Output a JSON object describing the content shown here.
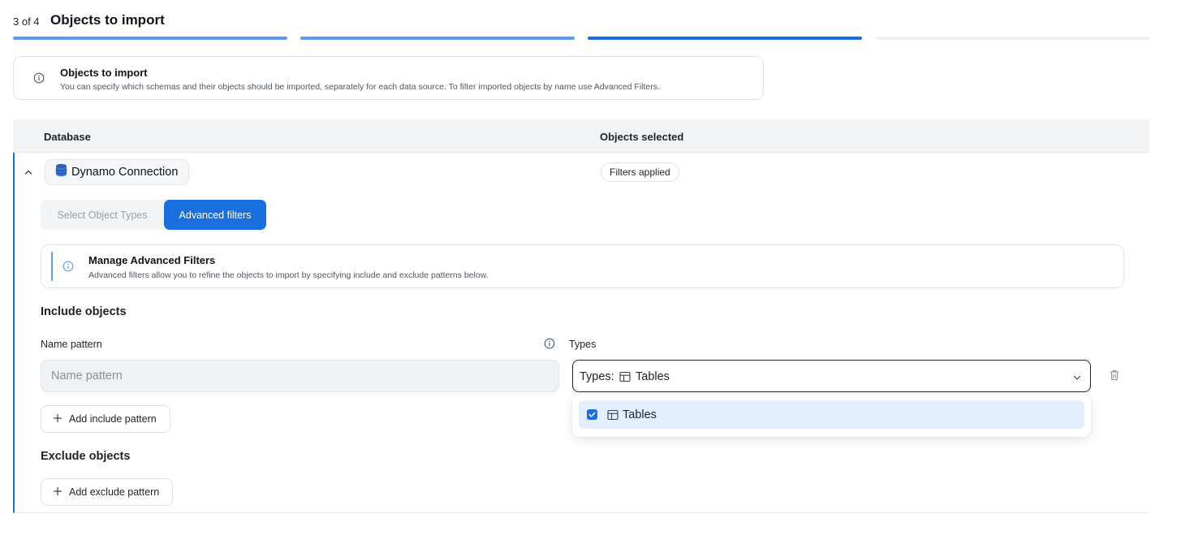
{
  "header": {
    "step": "3 of 4",
    "title": "Objects to import"
  },
  "progress": {
    "current_step": 3,
    "total_steps": 4
  },
  "info_card": {
    "title": "Objects to import",
    "description": "You can specify which schemas and their objects should be imported, separately for each data source. To filter imported objects by name use Advanced Filters."
  },
  "table": {
    "columns": [
      "Database",
      "Objects selected"
    ],
    "row": {
      "connection_name": "Dynamo Connection",
      "objects_selected": "Filters applied"
    }
  },
  "tabs": {
    "items": [
      "Select Object Types",
      "Advanced filters"
    ],
    "active": "Advanced filters"
  },
  "advanced_card": {
    "title": "Manage Advanced Filters",
    "description": "Advanced filters allow you to refine the objects to import by specifying include and exclude patterns below."
  },
  "include": {
    "title": "Include objects",
    "name_label": "Name pattern",
    "name_placeholder": "Name pattern",
    "types_label": "Types",
    "types_prefix": "Types:",
    "types_value": "Tables",
    "dropdown_options": [
      {
        "label": "Tables",
        "checked": true
      }
    ],
    "add_button": "Add include pattern"
  },
  "exclude": {
    "title": "Exclude objects",
    "add_button": "Add exclude pattern"
  },
  "colors": {
    "accent": "#1a6fe0",
    "progress_done": "#5a9cf0",
    "selected_option_bg": "#e3efff"
  },
  "icons": {
    "info": "info-circle-icon",
    "collapse": "chevron-up-icon",
    "database": "database-icon",
    "table": "table-grid-icon",
    "dropdown": "chevron-down-icon",
    "delete": "trash-icon",
    "add": "plus-icon",
    "checkbox": "check-icon"
  }
}
